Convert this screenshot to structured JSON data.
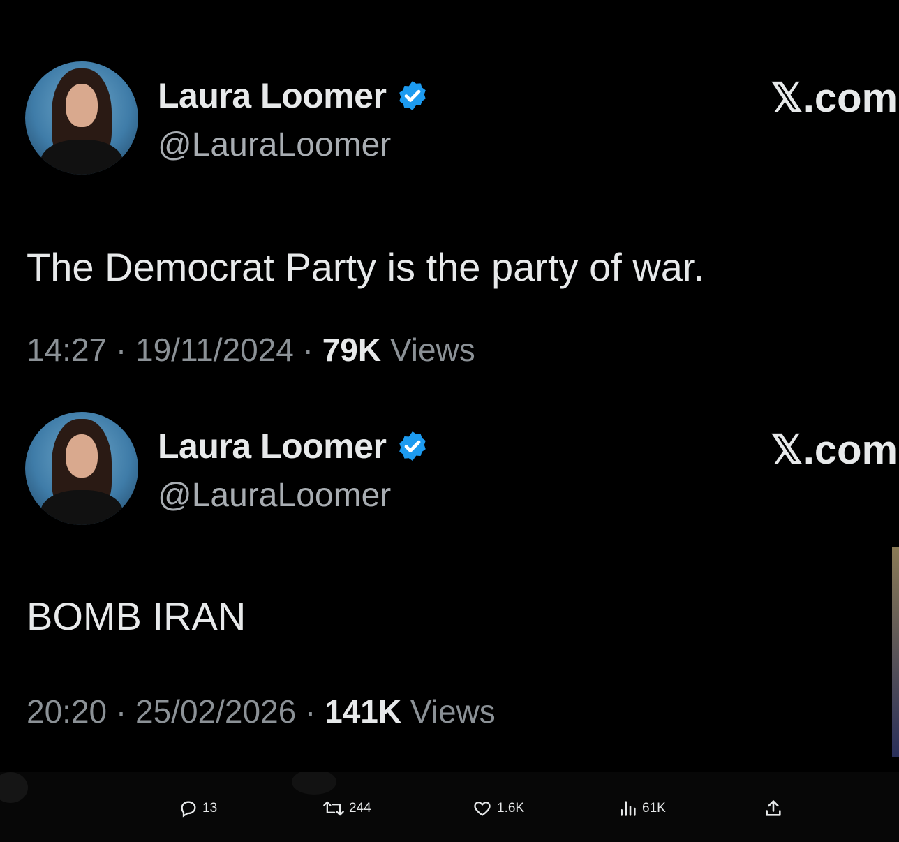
{
  "tweets": [
    {
      "name": "Laura Loomer",
      "handle": "@LauraLoomer",
      "site": "𝕏.com",
      "text": "The Democrat Party is the party of war.",
      "time": "14:27",
      "date": "19/11/2024",
      "views_count": "79K",
      "views_label": "Views"
    },
    {
      "name": "Laura Loomer",
      "handle": "@LauraLoomer",
      "site": "𝕏.com",
      "text": "BOMB IRAN",
      "time": "20:20",
      "date": "25/02/2026",
      "views_count": "141K",
      "views_label": "Views"
    }
  ],
  "separator": " · ",
  "bottom_actions": {
    "replies": "13",
    "reposts": "244",
    "likes": "1.6K",
    "views": "61K"
  },
  "colors": {
    "verified_badge": "#1d9bf0",
    "background": "#000000"
  },
  "icons": [
    "verified-badge-icon",
    "reply-icon",
    "repost-icon",
    "like-icon",
    "views-icon",
    "share-icon"
  ]
}
